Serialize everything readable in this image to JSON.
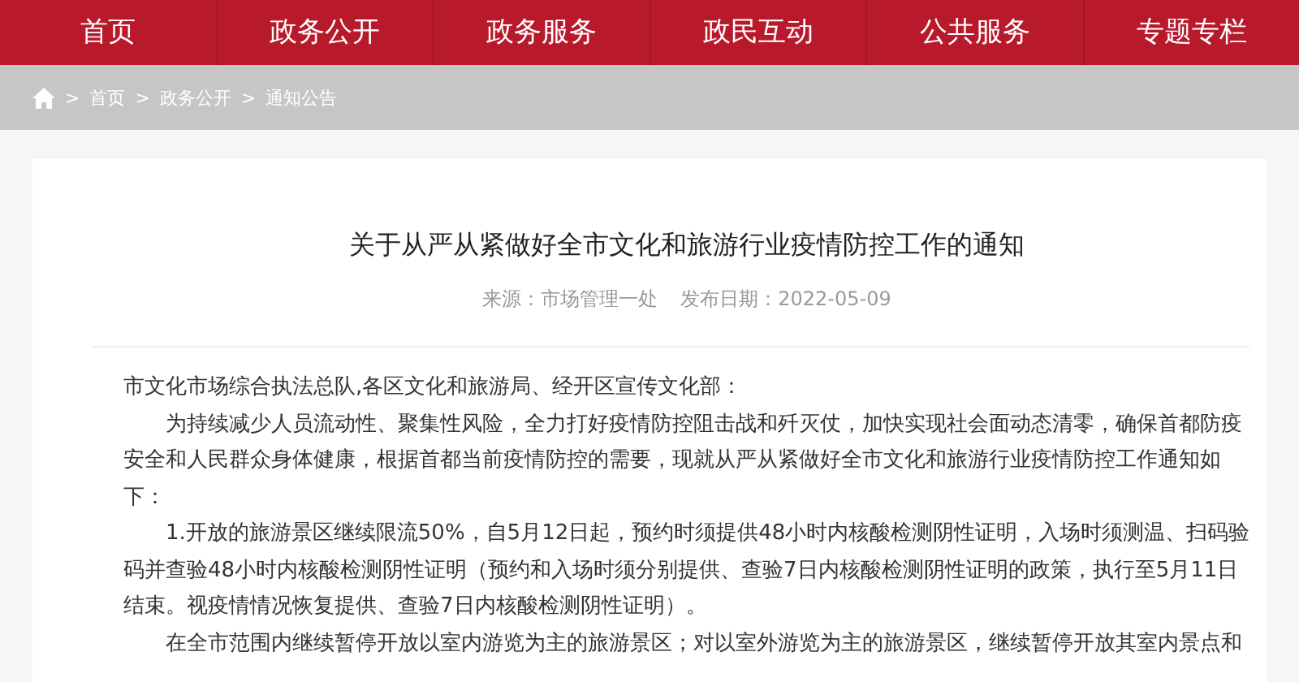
{
  "nav": [
    {
      "label": "首页"
    },
    {
      "label": "政务公开"
    },
    {
      "label": "政务服务"
    },
    {
      "label": "政民互动"
    },
    {
      "label": "公共服务"
    },
    {
      "label": "专题专栏"
    }
  ],
  "breadcrumb": [
    {
      "label": "首页"
    },
    {
      "label": "政务公开"
    },
    {
      "label": "通知公告"
    }
  ],
  "breadcrumb_separator": ">",
  "article": {
    "title": "关于从严从紧做好全市文化和旅游行业疫情防控工作的通知",
    "source": "来源：市场管理一处",
    "date": "发布日期：2022-05-09",
    "paragraphs": [
      {
        "kind": "salutation",
        "text": "市文化市场综合执法总队,各区文化和旅游局、经开区宣传文化部："
      },
      {
        "kind": "body",
        "text": "为持续减少人员流动性、聚集性风险，全力打好疫情防控阻击战和歼灭仗，加快实现社会面动态清零，确保首都防疫安全和人民群众身体健康，根据首都当前疫情防控的需要，现就从严从紧做好全市文化和旅游行业疫情防控工作通知如下："
      },
      {
        "kind": "body",
        "text": "1.开放的旅游景区继续限流50%，自5月12日起，预约时须提供48小时内核酸检测阴性证明，入场时须测温、扫码验码并查验48小时内核酸检测阴性证明（预约和入场时须分别提供、查验7日内核酸检测阴性证明的政策，执行至5月11日结束。视疫情情况恢复提供、查验7日内核酸检测阴性证明）。"
      },
      {
        "kind": "body",
        "text": "在全市范围内继续暂停开放以室内游览为主的旅游景区；对以室外游览为主的旅游景区，继续暂停开放其室内景点和"
      }
    ]
  }
}
